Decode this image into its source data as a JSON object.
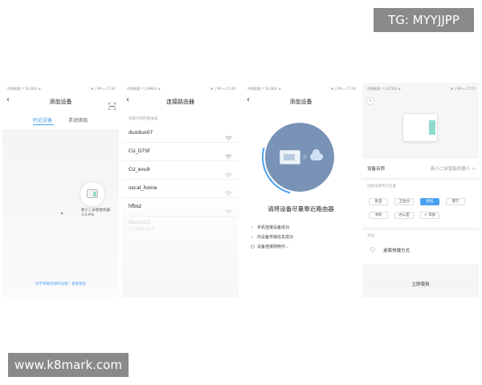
{
  "watermarks": {
    "top": "TG: MYYJJPP",
    "bottom": "www.k8mark.com"
  },
  "phone1": {
    "status_left": "中国联通 ⁴ᴳ 16.6K/s ⊗",
    "status_right": "✻ ▯ 99 ▭ 17:41",
    "title": "添加设备",
    "tab_active": "附近设备",
    "tab_inactive": "手动添加",
    "device_label": "新小二米智能机器人3.9%",
    "help_link": "扫不到要添加的设备？查看帮助"
  },
  "phone2": {
    "status_left": "中国联通 ⁴ᴳ 2.99K/s ⊗",
    "status_right": "✻ ▯ 99 ▭ 17:49",
    "title": "连接路由器",
    "list_header": "选择可用的路由器",
    "networks": [
      {
        "name": "duoduo07",
        "dim": false
      },
      {
        "name": "CU_O7SF",
        "dim": false
      },
      {
        "name": "CU_evu9",
        "dim": false
      },
      {
        "name": "oscal_home",
        "dim": false
      },
      {
        "name": "hfbsz",
        "dim": false
      },
      {
        "name": "Redmi2G",
        "dim": true
      }
    ],
    "dim_sub": "不支持5G Wi-Fi"
  },
  "phone3": {
    "status_left": "中国联通 ⁴ᴳ 26.0K/s ⊗",
    "status_right": "✻ ▯ 99 ▭ 17:54",
    "title": "添加设备",
    "prompt": "请将设备尽量靠近路由器",
    "steps": [
      {
        "text": "手机连接设备成功",
        "done": true
      },
      {
        "text": "向设备传输信息成功",
        "done": true
      },
      {
        "text": "设备连接网络中...",
        "done": false
      }
    ]
  },
  "phone4": {
    "status_left": "中国联通 ⁴ᴳ 2.67K/s ⊗",
    "status_right": "✻ ▯ 99 ▭ 17:55",
    "name_label": "设备名称",
    "name_value": "新小二米智能机器人 >",
    "room_label": "选择设备所在位置",
    "rooms": [
      "卧室",
      "卫生间",
      "厨房",
      "客厅",
      "书房",
      "办公室",
      "+ 添加"
    ],
    "selected_room": "厨房",
    "other_label": "其他",
    "shortcut_label": "桌面快捷方式",
    "use_button": "立即使用"
  },
  "colors": {
    "accent": "#4aa0f0",
    "circle": "#7993b7",
    "device_teal": "#8fdccb",
    "watermark": "#8a8a8a"
  },
  "icons": [
    "back-arrow-icon",
    "scan-icon",
    "wifi-icon",
    "router-icon",
    "cloud-icon",
    "check-icon"
  ]
}
